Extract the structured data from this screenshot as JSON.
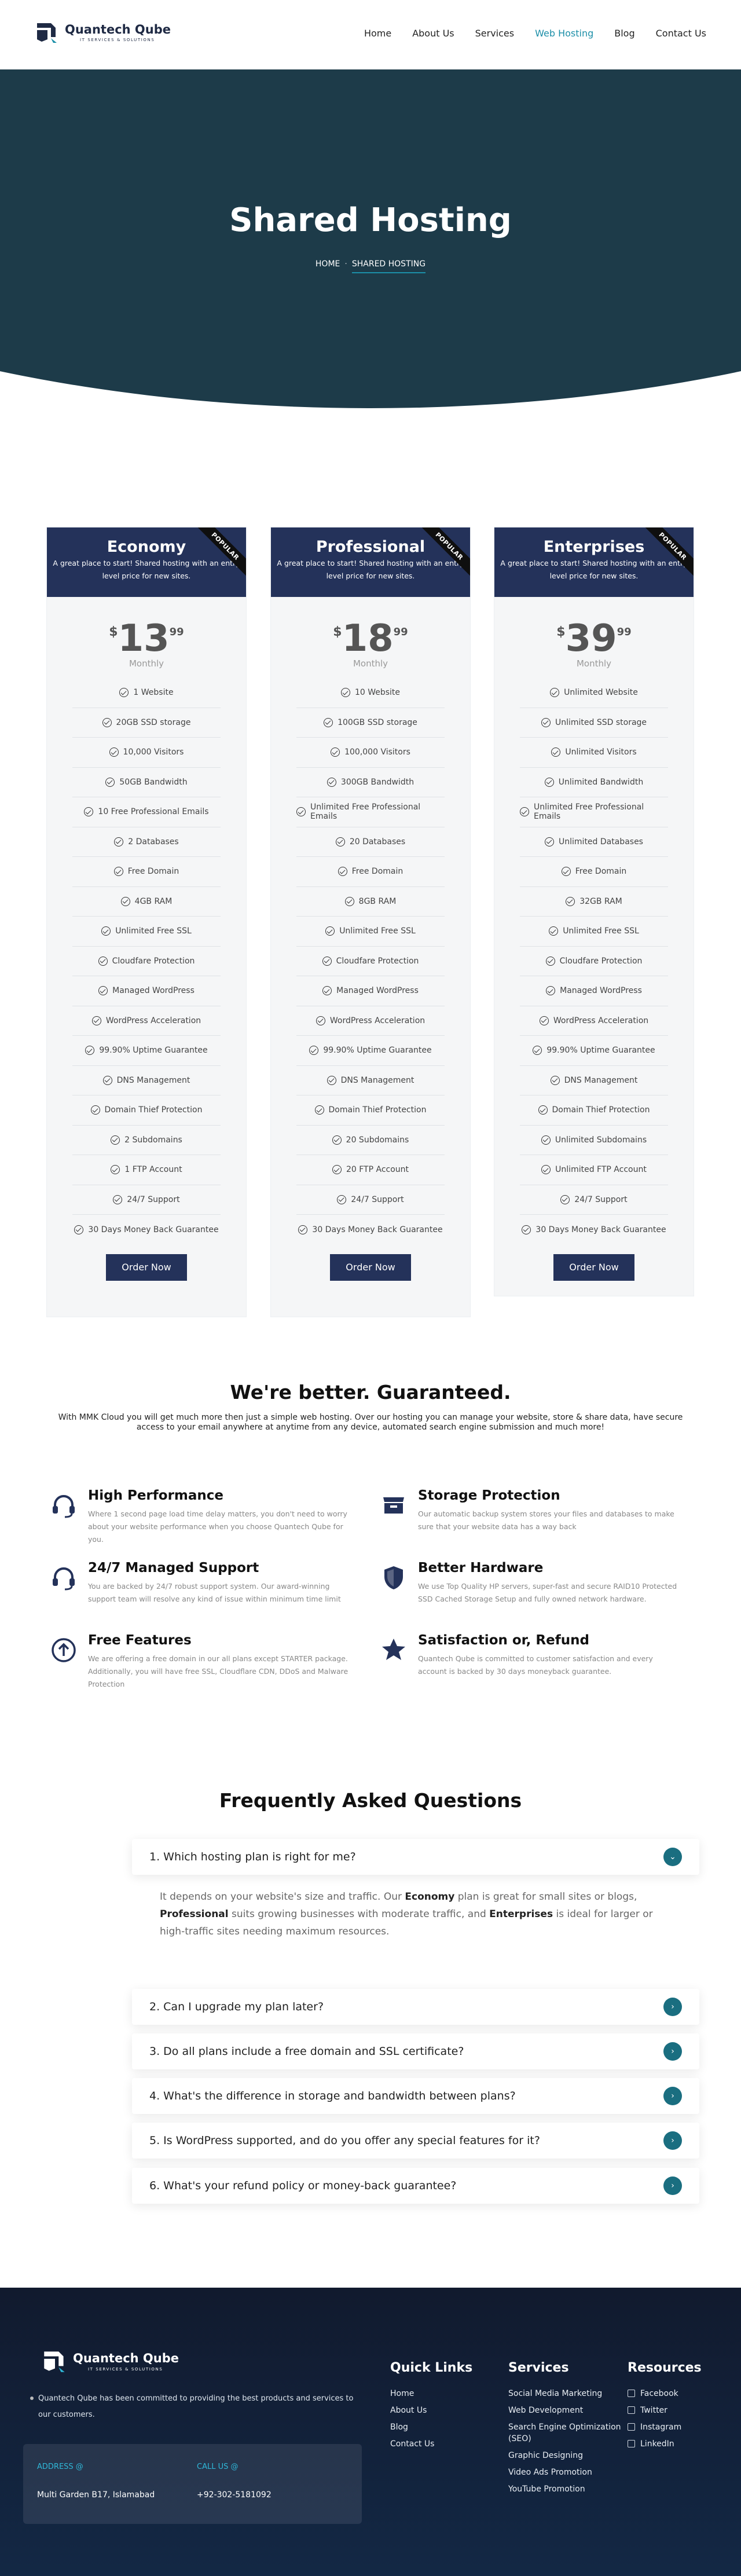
{
  "brand": {
    "name": "Quantech Qube",
    "tagline": "IT SERVICES & SOLUTIONS"
  },
  "nav": [
    "Home",
    "About Us",
    "Services",
    "Web Hosting",
    "Blog",
    "Contact Us"
  ],
  "hero": {
    "title": "Shared Hosting",
    "crumb_home": "HOME",
    "crumb_current": "SHARED HOSTING"
  },
  "plans": [
    {
      "name": "Economy",
      "desc": "A great place to start! Shared hosting with an entry level price for new sites.",
      "ribbon": "POPULAR",
      "currency": "$",
      "price": "13",
      "cents": "99",
      "period": "Monthly",
      "cta": "Order Now",
      "features": [
        "1 Website",
        "20GB SSD storage",
        "10,000 Visitors",
        "50GB Bandwidth",
        "10 Free Professional Emails",
        "2 Databases",
        "Free Domain",
        "4GB RAM",
        "Unlimited Free SSL",
        "Cloudfare Protection",
        "Managed WordPress",
        "WordPress Acceleration",
        "99.90% Uptime Guarantee",
        "DNS Management",
        "Domain Thief Protection",
        "2 Subdomains",
        "1 FTP Account",
        "24/7 Support",
        "30 Days Money Back Guarantee"
      ]
    },
    {
      "name": "Professional",
      "desc": "A great place to start! Shared hosting with an entry level price for new sites.",
      "ribbon": "POPULAR",
      "currency": "$",
      "price": "18",
      "cents": "99",
      "period": "Monthly",
      "cta": "Order Now",
      "features": [
        "10 Website",
        "100GB SSD storage",
        "100,000 Visitors",
        "300GB Bandwidth",
        "Unlimited Free Professional Emails",
        "20 Databases",
        "Free Domain",
        "8GB RAM",
        "Unlimited Free SSL",
        "Cloudfare Protection",
        "Managed WordPress",
        "WordPress Acceleration",
        "99.90% Uptime Guarantee",
        "DNS Management",
        "Domain Thief Protection",
        "20 Subdomains",
        "20 FTP Account",
        "24/7 Support",
        "30 Days Money Back Guarantee"
      ]
    },
    {
      "name": "Enterprises",
      "desc": "A great place to start! Shared hosting with an entry level price for new sites.",
      "ribbon": "POPULAR",
      "currency": "$",
      "price": "39",
      "cents": "99",
      "period": "Monthly",
      "cta": "Order Now",
      "features": [
        "Unlimited Website",
        "Unlimited SSD storage",
        "Unlimited Visitors",
        "Unlimited Bandwidth",
        "Unlimited Free Professional Emails",
        "Unlimited Databases",
        "Free Domain",
        "32GB RAM",
        "Unlimited Free SSL",
        "Cloudfare Protection",
        "Managed WordPress",
        "WordPress Acceleration",
        "99.90% Uptime Guarantee",
        "DNS Management",
        "Domain Thief Protection",
        "Unlimited Subdomains",
        "Unlimited FTP Account",
        "24/7 Support",
        "30 Days Money Back Guarantee"
      ]
    }
  ],
  "better": {
    "title": "We're better. Guaranteed.",
    "text": "With MMK Cloud you will get much more then just a simple web hosting. Over our hosting you can manage your website, store & share data, have secure access to your email anywhere at anytime from any device, automated search engine submission and much more!"
  },
  "features": [
    {
      "icon": "headset-icon",
      "title": "High Performance",
      "text": "Where 1 second page load time delay matters, you don't need to worry about your website performance when you choose Quantech Qube for you."
    },
    {
      "icon": "storage-icon",
      "title": "Storage Protection",
      "text": "Our automatic backup system stores your files and databases to make sure that your website data has a way back"
    },
    {
      "icon": "headset-icon",
      "title": "24/7 Managed Support",
      "text": "You are backed by 24/7 robust support system. Our award-winning support team will resolve any kind of issue within minimum time limit"
    },
    {
      "icon": "shield-icon",
      "title": "Better Hardware",
      "text": "We use Top Quality HP servers, super-fast and secure RAID10 Protected SSD Cached Storage Setup and fully owned network hardware."
    },
    {
      "icon": "arrow-up-circle-icon",
      "title": "Free Features",
      "text": "We are offering a free domain in our all plans except STARTER package. Additionally, you will have free SSL, Cloudflare CDN, DDoS and Malware Protection"
    },
    {
      "icon": "star-icon",
      "title": "Satisfaction or, Refund",
      "text": "Quantech Qube is committed to customer satisfaction and every account is backed by 30 days moneyback guarantee."
    }
  ],
  "faq": {
    "title": "Frequently Asked Questions",
    "questions": [
      "1. Which hosting plan is right for me?",
      "2. Can I upgrade my plan later?",
      "3. Do all plans include a free domain and SSL certificate?",
      "4. What's the difference in storage and bandwidth between plans?",
      "5. Is WordPress supported, and do you offer any special features for it?",
      "6. What's your refund policy or money-back guarantee?"
    ],
    "answer_1": {
      "a": "It depends on your website's size and traffic. Our ",
      "b": "Economy",
      "c": " plan is great for small sites or blogs, ",
      "d": "Professional",
      "e": " suits growing businesses with moderate traffic, and ",
      "f": "Enterprises",
      "g": " is ideal for larger or high-traffic sites needing maximum resources."
    }
  },
  "footer": {
    "desc": "Quantech Qube has been committed to providing the best products and services to our customers.",
    "address_label": "ADDRESS @",
    "address": "Multi Garden B17, Islamabad",
    "call_label": "CALL US @",
    "phone": "+92-302-5181092",
    "quick_title": "Quick Links",
    "quick": [
      "Home",
      "About Us",
      "Blog",
      "Contact Us"
    ],
    "services_title": "Services",
    "services": [
      "Social Media Marketing",
      "Web Development",
      "Search Engine Optimization (SEO)",
      "Graphic Designing",
      "Video Ads Promotion",
      "YouTube Promotion"
    ],
    "resources_title": "Resources",
    "resources": [
      "Facebook",
      "Twitter",
      "Instagram",
      "LinkedIn"
    ]
  }
}
